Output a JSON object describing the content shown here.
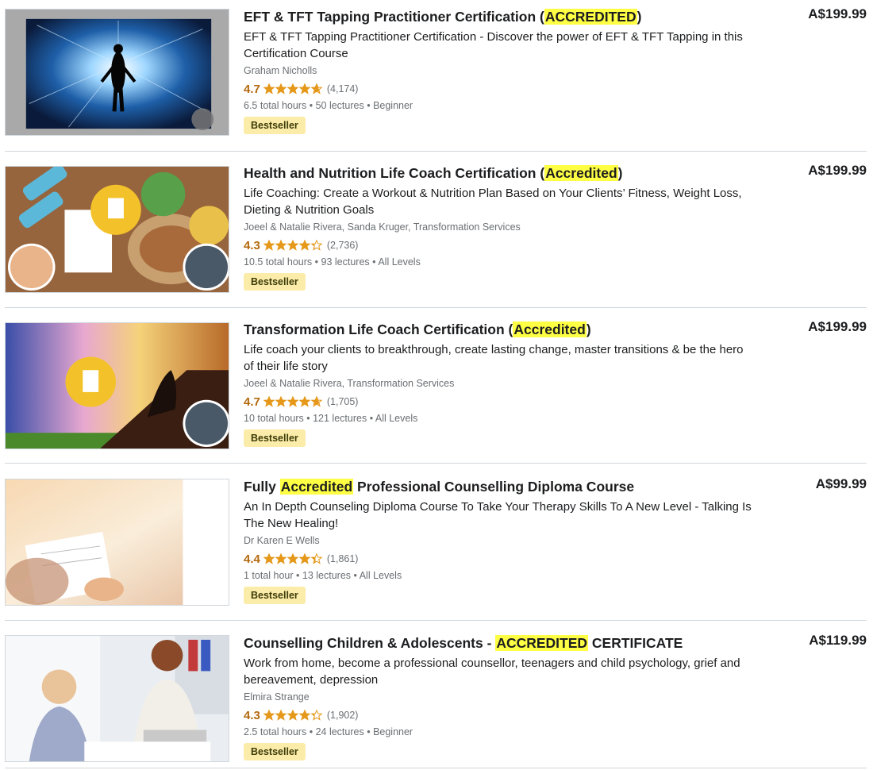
{
  "courses": [
    {
      "title_pre": "EFT & TFT Tapping Practitioner Certification (",
      "title_hl": "ACCREDITED",
      "title_post": ")",
      "description": "EFT & TFT Tapping Practitioner Certification - Discover the power of EFT & TFT Tapping in this Certification Course",
      "instructors": "Graham Nicholls",
      "rating": "4.7",
      "stars_value": 4.7,
      "reviews": "(4,174)",
      "hours": "6.5 total hours",
      "lectures": "50 lectures",
      "level": "Beginner",
      "badge": "Bestseller",
      "price": "A$199.99"
    },
    {
      "title_pre": "Health and Nutrition Life Coach Certification (",
      "title_hl": "Accredited",
      "title_post": ")",
      "description": "Life Coaching: Create a Workout & Nutrition Plan Based on Your Clients’ Fitness, Weight Loss, Dieting & Nutrition Goals",
      "instructors": "Joeel & Natalie Rivera, Sanda Kruger, Transformation Services",
      "rating": "4.3",
      "stars_value": 4.3,
      "reviews": "(2,736)",
      "hours": "10.5 total hours",
      "lectures": "93 lectures",
      "level": "All Levels",
      "badge": "Bestseller",
      "price": "A$199.99"
    },
    {
      "title_pre": "Transformation Life Coach Certification (",
      "title_hl": "Accredited",
      "title_post": ")",
      "description": "Life coach your clients to breakthrough, create lasting change, master transitions & be the hero of their life story",
      "instructors": "Joeel & Natalie Rivera, Transformation Services",
      "rating": "4.7",
      "stars_value": 4.7,
      "reviews": "(1,705)",
      "hours": "10 total hours",
      "lectures": "121 lectures",
      "level": "All Levels",
      "badge": "Bestseller",
      "price": "A$199.99"
    },
    {
      "title_pre": "Fully ",
      "title_hl": "Accredited",
      "title_post": " Professional Counselling Diploma Course",
      "description": "An In Depth Counseling Diploma Course To Take Your Therapy Skills To A New Level - Talking Is The New Healing!",
      "instructors": "Dr Karen E Wells",
      "rating": "4.4",
      "stars_value": 4.4,
      "reviews": "(1,861)",
      "hours": "1 total hour",
      "lectures": "13 lectures",
      "level": "All Levels",
      "badge": "Bestseller",
      "price": "A$99.99"
    },
    {
      "title_pre": "Counselling Children & Adolescents - ",
      "title_hl": "ACCREDITED",
      "title_post": " CERTIFICATE",
      "description": "Work from home, become a professional counsellor, teenagers and child psychology, grief and bereavement, depression",
      "instructors": "Elmira Strange",
      "rating": "4.3",
      "stars_value": 4.3,
      "reviews": "(1,902)",
      "hours": "2.5 total hours",
      "lectures": "24 lectures",
      "level": "Beginner",
      "badge": "Bestseller",
      "price": "A$119.99"
    }
  ],
  "colors": {
    "rating": "#b4690e",
    "star": "#e59819",
    "badge_bg": "#fceca9",
    "highlight": "#ffff44",
    "muted": "#6a6f73"
  },
  "icons": {
    "star": "star-icon",
    "dot": "bullet-dot"
  }
}
